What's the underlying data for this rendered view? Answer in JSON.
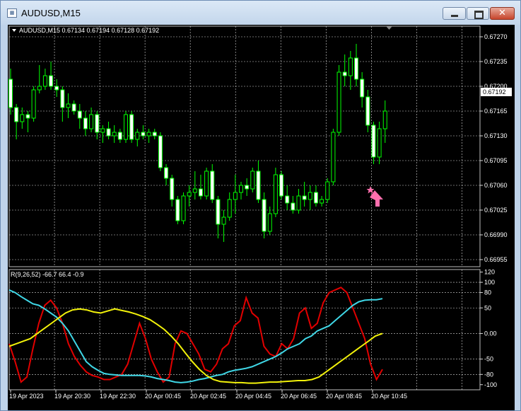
{
  "window": {
    "title": "AUDUSD,M15",
    "close_glyph": "✕"
  },
  "header": {
    "symbol_info": "AUDUSD,M15  0.67134 0.67194 0.67128 0.67192",
    "dropdown_glyph": "▼"
  },
  "price_axis": {
    "ticks": [
      "0.67270",
      "0.67235",
      "0.67200",
      "0.67165",
      "0.67130",
      "0.67095",
      "0.67060",
      "0.67025",
      "0.66990",
      "0.66955"
    ],
    "current_price": "0.67192"
  },
  "indicator": {
    "label": "R(9,26,52) -66.7 66.4 -0.9",
    "ticks": [
      "120",
      "100",
      "80",
      "50",
      "0.00",
      "-50",
      "-80",
      "-100"
    ]
  },
  "time_axis": {
    "labels": [
      "19 Apr 2023",
      "19 Apr 20:30",
      "19 Apr 22:30",
      "20 Apr 00:45",
      "20 Apr 02:45",
      "20 Apr 04:45",
      "20 Apr 06:45",
      "20 Apr 08:45",
      "20 Apr 10:45"
    ]
  },
  "colors": {
    "up_candle": "#00ff00",
    "down_candle": "#00ff00",
    "grid": "#d9d9d9",
    "red_line": "#e10000",
    "cyan_line": "#3fd7e6",
    "yellow_line": "#f2f20a",
    "arrow": "#ff6fae",
    "background": "#000000"
  },
  "icons": {
    "signal_star": "star-icon",
    "signal_arrow": "up-arrow-icon"
  },
  "chart_data": {
    "type": "candlestick",
    "price_range": [
      0.66945,
      0.67285
    ],
    "candles": [
      [
        0.6721,
        0.67225,
        0.6716,
        0.6717
      ],
      [
        0.6717,
        0.67175,
        0.67125,
        0.6715
      ],
      [
        0.6715,
        0.6717,
        0.6714,
        0.6716
      ],
      [
        0.6716,
        0.67165,
        0.67135,
        0.67155
      ],
      [
        0.67155,
        0.672,
        0.6715,
        0.67195
      ],
      [
        0.67195,
        0.6723,
        0.6719,
        0.672
      ],
      [
        0.672,
        0.67225,
        0.67195,
        0.67215
      ],
      [
        0.67215,
        0.67235,
        0.67195,
        0.672
      ],
      [
        0.672,
        0.6721,
        0.67185,
        0.67195
      ],
      [
        0.67195,
        0.672,
        0.6715,
        0.6717
      ],
      [
        0.6717,
        0.6719,
        0.67155,
        0.67175
      ],
      [
        0.67175,
        0.6718,
        0.6716,
        0.67165
      ],
      [
        0.67165,
        0.67175,
        0.6714,
        0.67155
      ],
      [
        0.67155,
        0.67165,
        0.6713,
        0.6714
      ],
      [
        0.6714,
        0.6717,
        0.67135,
        0.6716
      ],
      [
        0.6716,
        0.67165,
        0.67125,
        0.67135
      ],
      [
        0.67135,
        0.67145,
        0.6712,
        0.6714
      ],
      [
        0.6714,
        0.6715,
        0.67125,
        0.6713
      ],
      [
        0.6713,
        0.67145,
        0.6712,
        0.67135
      ],
      [
        0.67135,
        0.6714,
        0.6712,
        0.67125
      ],
      [
        0.67125,
        0.67165,
        0.6712,
        0.6716
      ],
      [
        0.6716,
        0.67165,
        0.6712,
        0.67125
      ],
      [
        0.67125,
        0.6714,
        0.67115,
        0.67135
      ],
      [
        0.67135,
        0.67145,
        0.67125,
        0.6713
      ],
      [
        0.6713,
        0.6714,
        0.6712,
        0.67135
      ],
      [
        0.67135,
        0.6714,
        0.67125,
        0.6713
      ],
      [
        0.6713,
        0.67135,
        0.6708,
        0.67085
      ],
      [
        0.67085,
        0.6709,
        0.6706,
        0.6707
      ],
      [
        0.6707,
        0.67075,
        0.6703,
        0.6704
      ],
      [
        0.6704,
        0.67045,
        0.67005,
        0.6701
      ],
      [
        0.6701,
        0.6705,
        0.67005,
        0.67045
      ],
      [
        0.67045,
        0.6706,
        0.6703,
        0.6705
      ],
      [
        0.6705,
        0.6708,
        0.6704,
        0.67055
      ],
      [
        0.67055,
        0.67075,
        0.6704,
        0.67045
      ],
      [
        0.67045,
        0.67085,
        0.6704,
        0.6708
      ],
      [
        0.6708,
        0.6709,
        0.67035,
        0.6704
      ],
      [
        0.6704,
        0.67045,
        0.66985,
        0.67005
      ],
      [
        0.67005,
        0.67025,
        0.6698,
        0.67015
      ],
      [
        0.67015,
        0.6705,
        0.6701,
        0.6704
      ],
      [
        0.6704,
        0.67075,
        0.6702,
        0.6705
      ],
      [
        0.6705,
        0.67065,
        0.6704,
        0.6706
      ],
      [
        0.6706,
        0.6707,
        0.67045,
        0.67055
      ],
      [
        0.67055,
        0.67085,
        0.6705,
        0.6708
      ],
      [
        0.6708,
        0.67095,
        0.67035,
        0.6704
      ],
      [
        0.6704,
        0.6705,
        0.66985,
        0.66995
      ],
      [
        0.66995,
        0.6703,
        0.6699,
        0.6702
      ],
      [
        0.6702,
        0.67085,
        0.67015,
        0.67075
      ],
      [
        0.67075,
        0.6708,
        0.6704,
        0.67045
      ],
      [
        0.67045,
        0.6706,
        0.67025,
        0.67035
      ],
      [
        0.67035,
        0.67045,
        0.6702,
        0.67025
      ],
      [
        0.67025,
        0.67055,
        0.6702,
        0.67045
      ],
      [
        0.67045,
        0.67065,
        0.6703,
        0.6704
      ],
      [
        0.6704,
        0.6706,
        0.67025,
        0.6705
      ],
      [
        0.6705,
        0.6706,
        0.6703,
        0.67035
      ],
      [
        0.67035,
        0.67045,
        0.6703,
        0.6704
      ],
      [
        0.6704,
        0.6707,
        0.67035,
        0.67065
      ],
      [
        0.67065,
        0.6714,
        0.6706,
        0.67135
      ],
      [
        0.67135,
        0.6723,
        0.6713,
        0.6722
      ],
      [
        0.6722,
        0.67245,
        0.672,
        0.67215
      ],
      [
        0.67215,
        0.6725,
        0.67195,
        0.6724
      ],
      [
        0.6724,
        0.6726,
        0.672,
        0.6721
      ],
      [
        0.6721,
        0.6722,
        0.6717,
        0.67185
      ],
      [
        0.67185,
        0.67195,
        0.67135,
        0.67145
      ],
      [
        0.67145,
        0.6715,
        0.6709,
        0.671
      ],
      [
        0.671,
        0.6715,
        0.6709,
        0.6714
      ],
      [
        0.6714,
        0.6718,
        0.6712,
        0.67165
      ]
    ],
    "indicator_series": [
      {
        "name": "red",
        "values": [
          -20,
          -55,
          -95,
          -85,
          -30,
          20,
          55,
          65,
          50,
          20,
          -20,
          -45,
          -62,
          -75,
          -82,
          -85,
          -90,
          -90,
          -85,
          -80,
          -60,
          -20,
          20,
          -10,
          -50,
          -75,
          -95,
          -85,
          -20,
          5,
          0,
          -20,
          -40,
          -70,
          -75,
          -60,
          -30,
          -20,
          15,
          25,
          70,
          40,
          30,
          -25,
          -40,
          -45,
          -20,
          -30,
          -10,
          40,
          50,
          10,
          20,
          60,
          80,
          85,
          90,
          80,
          50,
          20,
          -10,
          -60,
          -90,
          -70
        ]
      },
      {
        "name": "cyan",
        "values": [
          85,
          80,
          72,
          65,
          58,
          55,
          48,
          40,
          32,
          20,
          5,
          -15,
          -35,
          -55,
          -65,
          -72,
          -78,
          -80,
          -81,
          -82,
          -82,
          -82,
          -82,
          -83,
          -85,
          -88,
          -90,
          -92,
          -95,
          -96,
          -95,
          -93,
          -90,
          -88,
          -85,
          -82,
          -80,
          -75,
          -72,
          -70,
          -68,
          -65,
          -60,
          -55,
          -50,
          -45,
          -38,
          -30,
          -25,
          -20,
          -10,
          -5,
          5,
          10,
          15,
          25,
          35,
          45,
          55,
          62,
          65,
          66,
          66,
          68
        ]
      },
      {
        "name": "yellow",
        "values": [
          -25,
          -20,
          -15,
          -10,
          0,
          10,
          20,
          30,
          40,
          46,
          48,
          46,
          42,
          40,
          44,
          48,
          45,
          42,
          38,
          33,
          27,
          18,
          8,
          -5,
          -20,
          -38,
          -55,
          -70,
          -82,
          -90,
          -94,
          -95,
          -96,
          -96,
          -97,
          -97,
          -96,
          -95,
          -95,
          -94,
          -93,
          -92,
          -92,
          -90,
          -85,
          -75,
          -65,
          -55,
          -45,
          -35,
          -25,
          -15,
          -5,
          0
        ]
      }
    ],
    "indicator_range": [
      -110,
      125
    ]
  }
}
